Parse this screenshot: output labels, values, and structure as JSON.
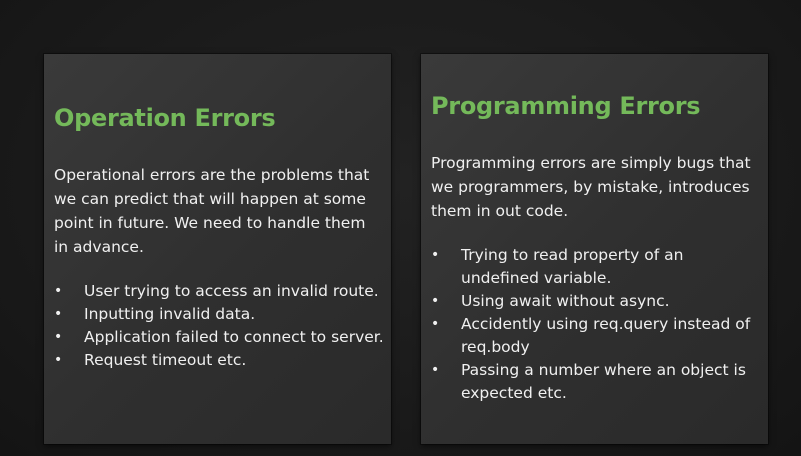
{
  "slide": {
    "left_card": {
      "title": "Operation Errors",
      "description": "Operational errors are the problems that we can predict that will happen at some point in future. We need to handle them in advance.",
      "bullets": [
        "User trying to access an invalid route.",
        "Inputting invalid data.",
        "Application failed to connect to server.",
        "Request timeout etc."
      ]
    },
    "right_card": {
      "title": "Programming Errors",
      "description": "Programming errors are simply bugs that we programmers, by mistake, introduces them in out code.",
      "bullets": [
        "Trying to read property of an undefined variable.",
        "Using await without async.",
        "Accidently using req.query instead of req.body",
        "Passing a number where an object is expected etc."
      ]
    },
    "bullet_glyph": "•"
  },
  "colors": {
    "title_green": "#74b95a",
    "card_bg": "#353535",
    "page_bg": "#1c1c1c",
    "text": "#f0f0f0"
  }
}
